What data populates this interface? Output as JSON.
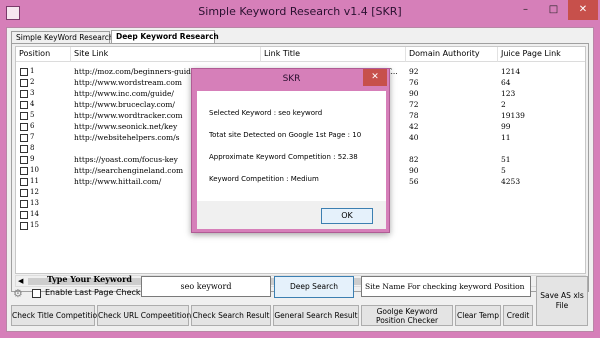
{
  "window": {
    "title": "Simple Keyword Research v1.4 [SKR]",
    "min": "–",
    "max": "□",
    "close": "✕"
  },
  "tabs": [
    "Simple KeyWord Research",
    "Deep Keyword Research"
  ],
  "grid": {
    "headers": [
      "Position",
      "Site Link",
      "Link Title",
      "Domain Authority",
      "Juice Page Link"
    ],
    "rows": [
      {
        "pos": "1",
        "link": "http://moz.com/beginners-guide-to-seo/key",
        "title": "How To Do Keyword Research - T...",
        "da": "92",
        "juice": "1214"
      },
      {
        "pos": "2",
        "link": "http://www.wordstream.com",
        "title": "",
        "da": "76",
        "juice": "64"
      },
      {
        "pos": "3",
        "link": "http://www.inc.com/guide/",
        "title": "",
        "da": "90",
        "juice": "123"
      },
      {
        "pos": "4",
        "link": "http://www.bruceclay.com/",
        "title": "",
        "da": "72",
        "juice": "2"
      },
      {
        "pos": "5",
        "link": "http://www.wordtracker.com",
        "title": "",
        "da": "78",
        "juice": "19139"
      },
      {
        "pos": "6",
        "link": "http://www.seonick.net/key",
        "title": "",
        "da": "42",
        "juice": "99"
      },
      {
        "pos": "7",
        "link": "http://websitehelpers.com/s",
        "title": "",
        "da": "40",
        "juice": "11"
      },
      {
        "pos": "8",
        "link": "",
        "title": "",
        "da": "",
        "juice": ""
      },
      {
        "pos": "9",
        "link": "https://yoast.com/focus-key",
        "title": "",
        "da": "82",
        "juice": "51"
      },
      {
        "pos": "10",
        "link": "http://searchengineland.com",
        "title": "",
        "da": "90",
        "juice": "5"
      },
      {
        "pos": "11",
        "link": "http://www.hittail.com/",
        "title": "",
        "da": "56",
        "juice": "4253"
      },
      {
        "pos": "12",
        "link": "",
        "title": "",
        "da": "",
        "juice": ""
      },
      {
        "pos": "13",
        "link": "",
        "title": "",
        "da": "",
        "juice": ""
      },
      {
        "pos": "14",
        "link": "",
        "title": "",
        "da": "",
        "juice": ""
      },
      {
        "pos": "15",
        "link": "",
        "title": "",
        "da": "",
        "juice": ""
      }
    ]
  },
  "controls": {
    "type_keyword_label": "Type Your Keyword",
    "last_page_label": "Enable Last Page Checking",
    "keyword_value": "seo keyword",
    "deep_search": "Deep Search",
    "site_name_placeholder": "Site Name For checking keyword Position",
    "save_xls": "Save AS xls File"
  },
  "buttons": {
    "check_title": "Check Title Competition",
    "check_url": "Check URL Compeetition",
    "check_search": "Check Search Result",
    "general_search": "General Search Result",
    "google_position": "Goolge Keyword Position Checker",
    "clear_temp": "Clear Temp",
    "credit": "Credit"
  },
  "dialog": {
    "title": "SKR",
    "close": "✕",
    "lines": [
      "Selected Keyword : seo keyword",
      "Totat site Detected on Google 1st Page : 10",
      "Approximate Keyword Competition : 52.38",
      "Keyword Competition : Medium"
    ],
    "ok": "OK"
  },
  "colors": {
    "frame": "#d67fb9",
    "close": "#c7504b"
  }
}
